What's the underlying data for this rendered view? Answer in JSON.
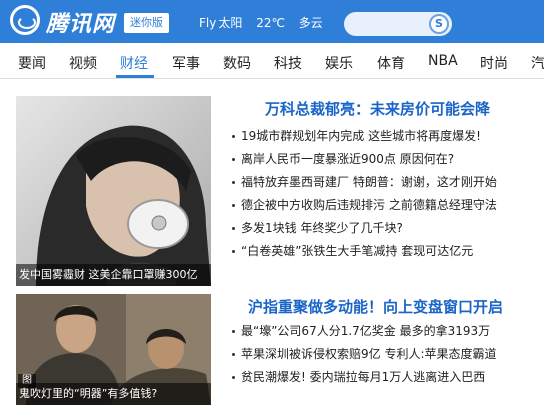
{
  "header": {
    "brand": "腾讯网",
    "edition": "迷你版",
    "weather": {
      "label": "Fly",
      "icon_text": "太阳",
      "temperature": "22℃",
      "condition": "多云"
    },
    "search_icon": "search-icon",
    "accent_color": "#2f7fd8"
  },
  "nav": {
    "items": [
      "要闻",
      "视频",
      "财经",
      "军事",
      "数码",
      "科技",
      "娱乐",
      "体育",
      "NBA",
      "时尚",
      "汽"
    ],
    "active_index": 2
  },
  "block1": {
    "photo_caption": "发中国雾霾财 这美企靠口罩赚300亿",
    "headline": "万科总裁郁亮：未来房价可能会降",
    "items": [
      "19城市群规划年内完成 这些城市将再度爆发!",
      "离岸人民币一度暴涨近900点 原因何在?",
      "福特放弃墨西哥建厂 特朗普：谢谢，这才刚开始",
      "德企被中方收购后违规排污 之前德籍总经理守法",
      "多发1块钱 年终奖少了几千块?",
      "“白卷英雄”张铁生大手笔减持 套现可达亿元"
    ]
  },
  "block2": {
    "photo_badge": "图",
    "photo_caption": "鬼吹灯里的“明器”有多值钱?",
    "headline": "沪指重聚做多动能！向上变盘窗口开启",
    "items": [
      "最“壕”公司67人分1.7亿奖金 最多的拿3193万",
      "苹果深圳被诉侵权索赔9亿 专利人:苹果态度霸道",
      "贫民潮爆发! 委内瑞拉每月1万人逃离进入巴西"
    ]
  }
}
